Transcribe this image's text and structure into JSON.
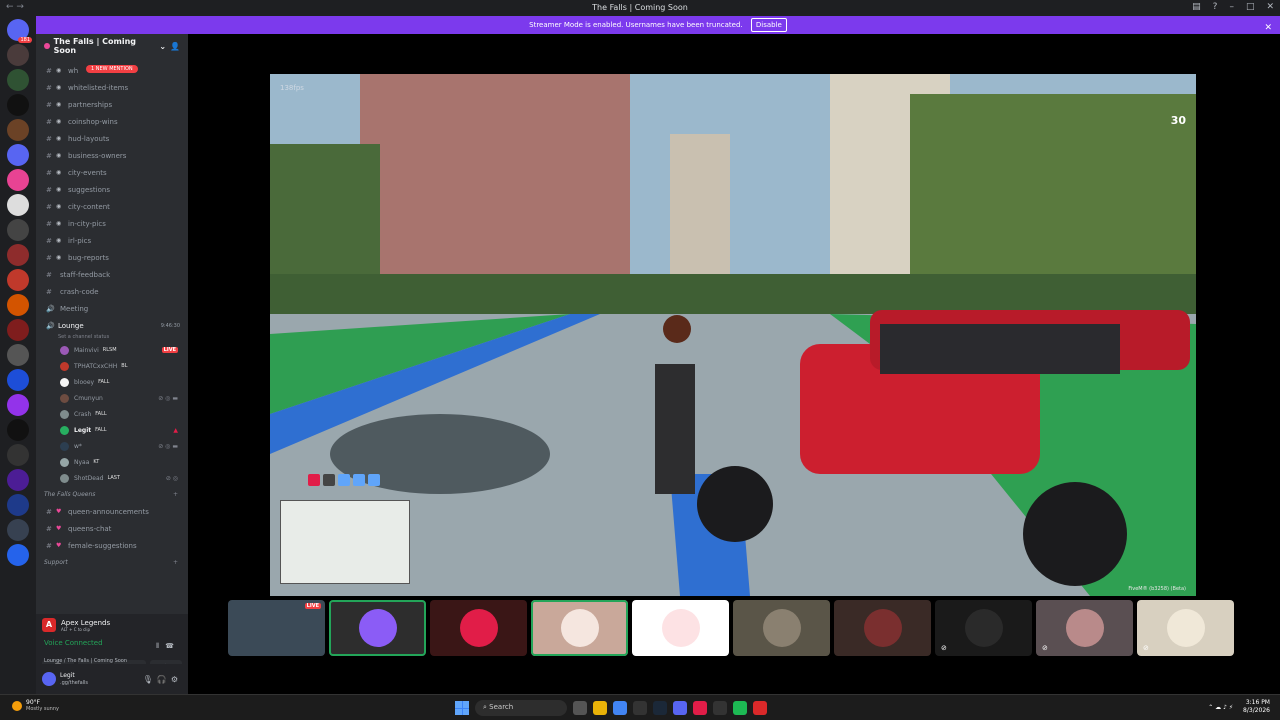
{
  "window": {
    "title": "The Falls | Coming Soon"
  },
  "banner": {
    "text": "Streamer Mode is enabled. Usernames have been truncated.",
    "button": "Disable"
  },
  "server": {
    "name": "The Falls | Coming Soon"
  },
  "mention_pill": "1 NEW MENTION",
  "channels": [
    {
      "name": "wh",
      "type": "forum"
    },
    {
      "name": "whitelisted-items",
      "type": "forum"
    },
    {
      "name": "partnerships",
      "type": "forum"
    },
    {
      "name": "coinshop-wins",
      "type": "forum"
    },
    {
      "name": "hud-layouts",
      "type": "forum"
    },
    {
      "name": "business-owners",
      "type": "forum"
    },
    {
      "name": "city-events",
      "type": "forum"
    },
    {
      "name": "suggestions",
      "type": "forum"
    },
    {
      "name": "city-content",
      "type": "forum"
    },
    {
      "name": "in-city-pics",
      "type": "forum"
    },
    {
      "name": "irl-pics",
      "type": "forum"
    },
    {
      "name": "bug-reports",
      "type": "forum"
    },
    {
      "name": "staff-feedback",
      "type": "text"
    },
    {
      "name": "crash-code",
      "type": "text"
    },
    {
      "name": "Meeting",
      "type": "text"
    }
  ],
  "voice_channel": {
    "name": "Lounge",
    "timer": "9:46:30",
    "status": "Set a channel status"
  },
  "voice_users": [
    {
      "name": "Mainvivi",
      "tag": "RLSM",
      "live": "LIVE",
      "color": "#9b59b6"
    },
    {
      "name": "TPHATCxxCHH",
      "tag": "BL",
      "live": "",
      "color": "#c0392b"
    },
    {
      "name": "blooey",
      "tag": "FALL",
      "live": "",
      "color": "#f5f5f5"
    },
    {
      "name": "Cmunyun",
      "tag": "",
      "live": "",
      "color": "#6d4c41"
    },
    {
      "name": "Crash",
      "tag": "FALL",
      "live": "",
      "color": "#7f8c8d"
    },
    {
      "name": "Legit",
      "tag": "FALL",
      "live": "",
      "color": "#27ae60"
    },
    {
      "name": "w*",
      "tag": "",
      "live": "",
      "color": "#2c3e50"
    },
    {
      "name": "Nyaa",
      "tag": "KT",
      "live": "",
      "color": "#95a5a6"
    },
    {
      "name": "ShotDead",
      "tag": "LAST",
      "live": "",
      "color": "#7f8c8d"
    }
  ],
  "category_queens": "The Falls Queens",
  "queens_channels": [
    {
      "name": "queen-announcements"
    },
    {
      "name": "queens-chat"
    },
    {
      "name": "female-suggestions"
    }
  ],
  "category_support": "Support",
  "activity": {
    "game": "Apex Legends",
    "sub": "ALT + C to clip"
  },
  "voice_connected": {
    "title": "Voice Connected",
    "sub": "Lounge / The Falls | Coming Soon"
  },
  "user": {
    "name": "Legit",
    "handle": ".gg/thefalls"
  },
  "stream": {
    "fps": "138fps",
    "counter": "30",
    "watermark": "FiveM® (b3258) (Beta)"
  },
  "thumbs": [
    {
      "live": "LIVE",
      "color": "#3b4a57"
    },
    {
      "live": "",
      "color": "#2d2d2d",
      "circle": "#8b5cf6"
    },
    {
      "live": "",
      "color": "#3a1616",
      "circle": "#e11d48"
    },
    {
      "live": "",
      "color": "#c9a89a",
      "circle": "#f5e6df"
    },
    {
      "live": "",
      "color": "#ffffff",
      "circle": "#fde2e4"
    },
    {
      "live": "",
      "color": "#5a5548",
      "circle": "#8a8070"
    },
    {
      "live": "",
      "color": "#3a2a26",
      "circle": "#7a2f2f"
    },
    {
      "live": "",
      "color": "#1a1a1a",
      "circle": "#2a2a2a"
    },
    {
      "live": "",
      "color": "#5a4f52",
      "circle": "#b98a8a"
    },
    {
      "live": "",
      "color": "#d8d0c0",
      "circle": "#f0e8d8"
    }
  ],
  "taskbar": {
    "temp": "90°F",
    "condition": "Mostly sunny",
    "search": "Search",
    "time": "3:16 PM",
    "date": "8/3/2026"
  }
}
